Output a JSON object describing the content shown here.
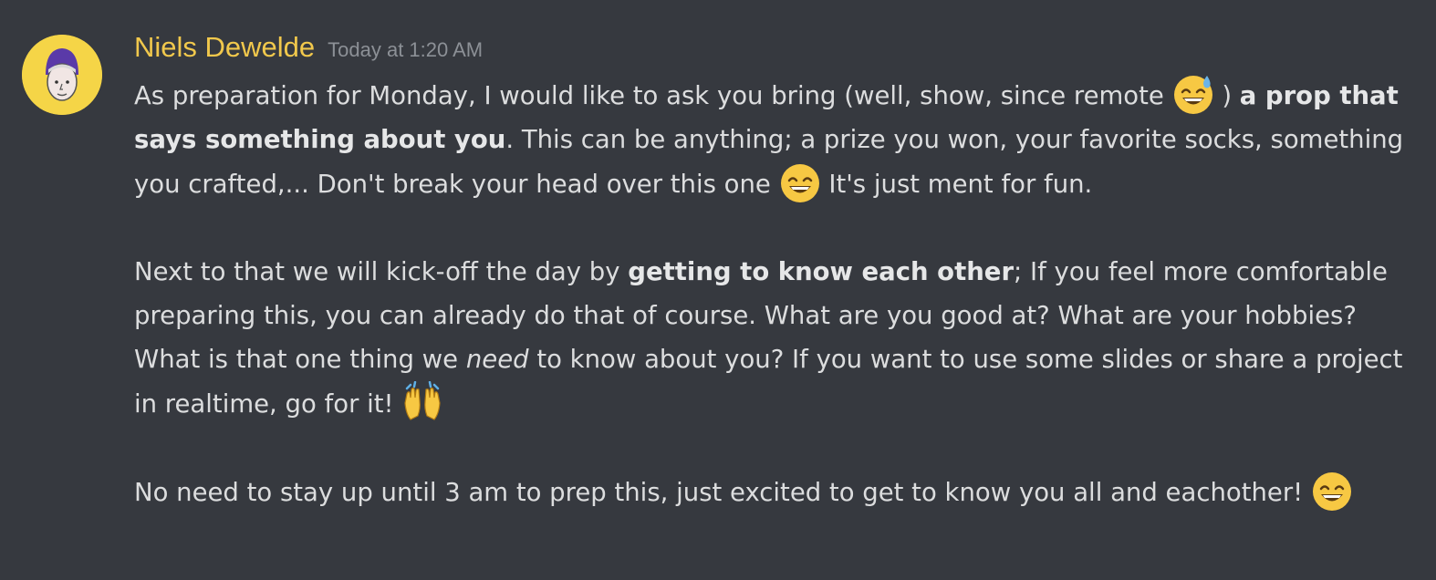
{
  "message": {
    "author": "Niels Dewelde",
    "timestamp": "Today at 1:20 AM",
    "author_color": "#f1c84c",
    "avatar_icon": "user-avatar-icon",
    "paragraphs": [
      {
        "s1": "As preparation for Monday, I would like to ask you bring (well, show, since remote ",
        "emoji1": "sweat-smile-emoji-icon",
        "s2": " ) ",
        "bold1": "a prop that says something about you",
        "s3": ". This can be anything; a prize you won, your favorite socks, something you crafted,... Don't break your head over this one ",
        "emoji2": "smile-emoji-icon",
        "s4": " It's just ment for fun."
      },
      {
        "s1": "Next to that we will kick-off the day by ",
        "bold1": "getting to know each other",
        "s2": "; If you feel more comfortable preparing this, you can already do that of course. What are you good at? What are your hobbies? What is that one thing we ",
        "italic1": "need",
        "s3": " to know about you? If you want to use some slides or share a project in realtime, go for it! ",
        "emoji1": "raising-hands-emoji-icon"
      },
      {
        "s1": "No need to stay up until 3 am to prep this, just excited to get to know you all and eachother! ",
        "emoji1": "smile-emoji-icon"
      }
    ]
  }
}
